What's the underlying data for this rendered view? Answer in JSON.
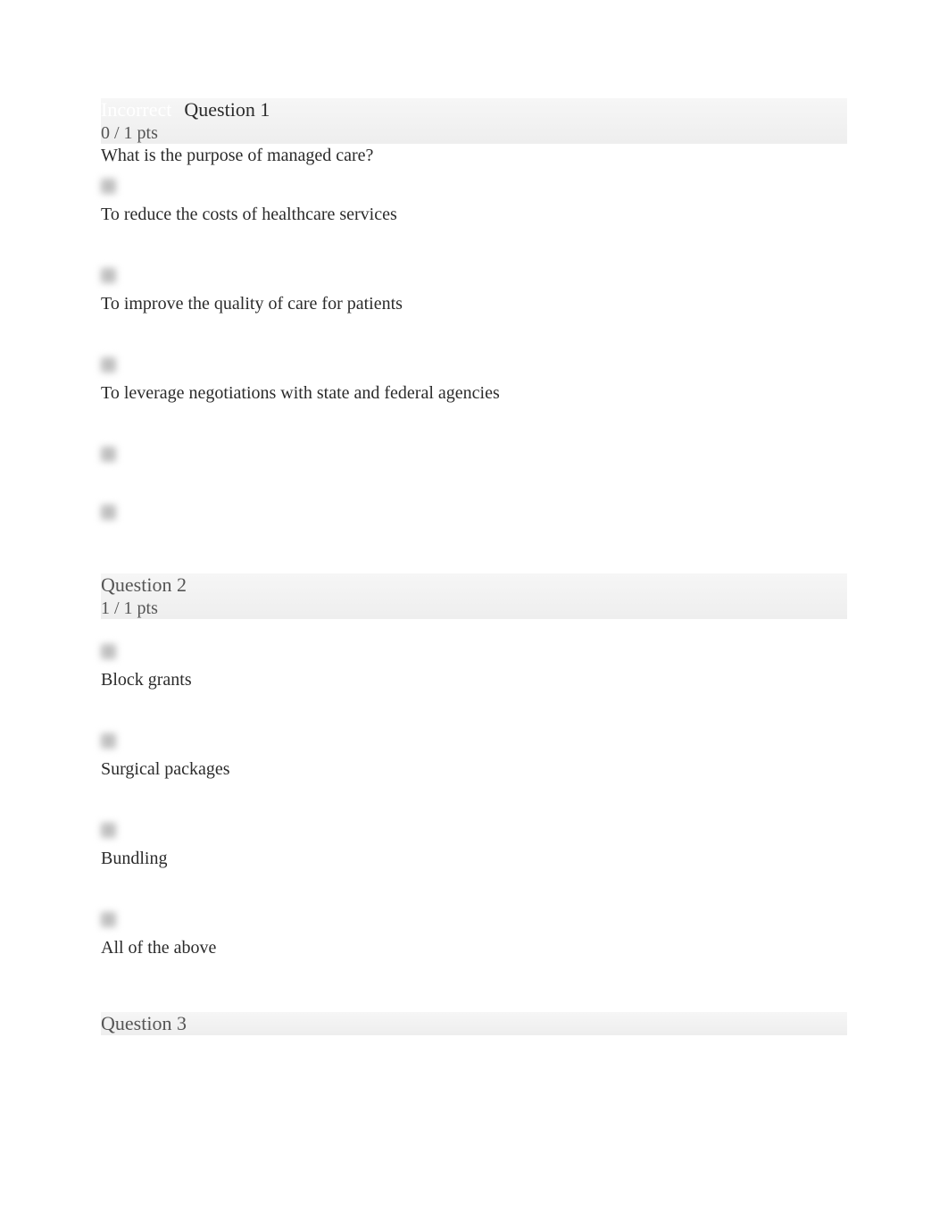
{
  "questions": [
    {
      "status_label": "Incorrect",
      "title": "Question 1",
      "points": "0 / 1 pts",
      "prompt": "What is the purpose of managed care?",
      "options": [
        {
          "text": "To reduce the costs of healthcare services"
        },
        {
          "text": "To improve the quality of care for patients"
        },
        {
          "text": "To leverage negotiations with state and federal agencies"
        },
        {
          "text": ""
        },
        {
          "text": ""
        }
      ]
    },
    {
      "title": "Question 2",
      "points": "1 / 1 pts",
      "options": [
        {
          "text": "Block grants"
        },
        {
          "text": "Surgical packages"
        },
        {
          "text": "Bundling"
        },
        {
          "text": "All of the above"
        }
      ]
    },
    {
      "title": "Question 3"
    }
  ]
}
